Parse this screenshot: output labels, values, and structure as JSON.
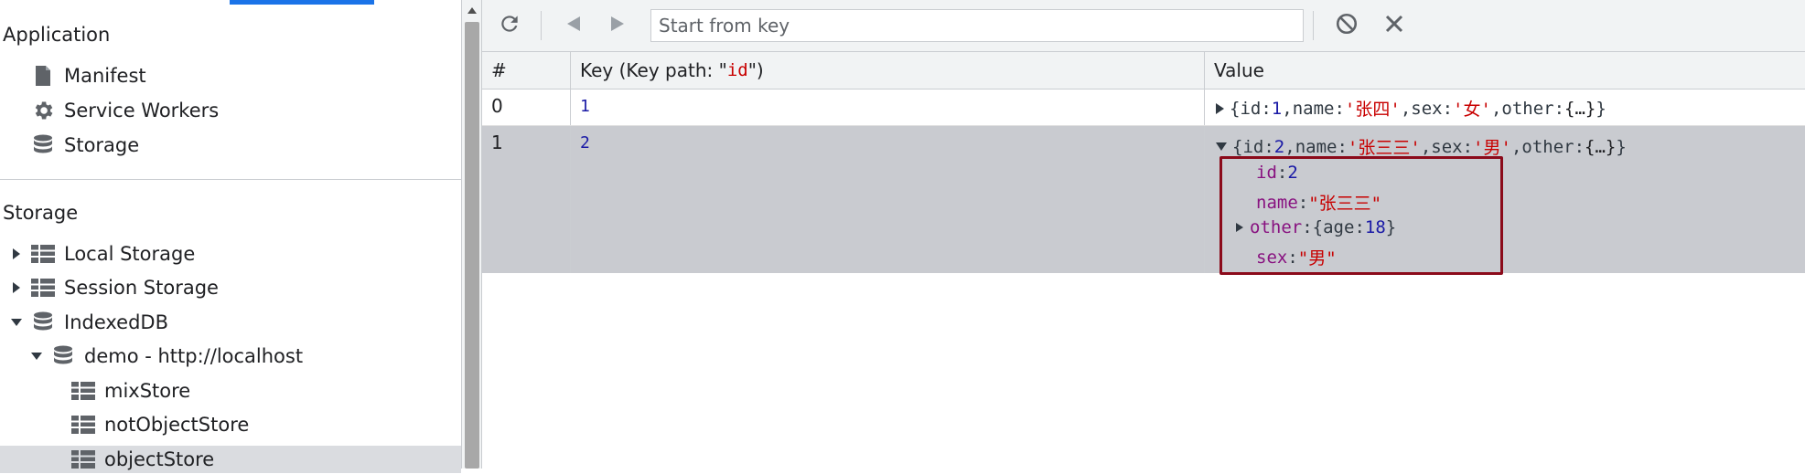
{
  "sidebar": {
    "application_title": "Application",
    "app_items": [
      "Manifest",
      "Service Workers",
      "Storage"
    ],
    "storage_title": "Storage",
    "storage_items": {
      "local_storage": "Local Storage",
      "session_storage": "Session Storage",
      "indexeddb": "IndexedDB",
      "database": "demo - http://localhost",
      "stores": [
        "mixStore",
        "notObjectStore",
        "objectStore"
      ]
    },
    "selected_store": "objectStore"
  },
  "toolbar": {
    "search_placeholder": "Start from key",
    "icons": [
      "refresh-icon",
      "prev-page-icon",
      "next-page-icon",
      "clear-icon",
      "delete-icon"
    ]
  },
  "table": {
    "headers": {
      "index": "#",
      "key_prefix": "Key (Key path: \"",
      "key_path": "id",
      "key_suffix": "\")",
      "value": "Value"
    },
    "rows": [
      {
        "index": "0",
        "key": "1",
        "value_preview": {
          "open": "{",
          "id_label": "id",
          "id": "1",
          "name_label": "name",
          "name": "'张四'",
          "sex_label": "sex",
          "sex": "'女'",
          "other_label": "other",
          "other": "{…}",
          "close": "}"
        }
      },
      {
        "index": "1",
        "key": "2",
        "expanded": true,
        "value_preview": {
          "open": "{",
          "id_label": "id",
          "id": "2",
          "name_label": "name",
          "name": "'张三三'",
          "sex_label": "sex",
          "sex": "'男'",
          "other_label": "other",
          "other": "{…}",
          "close": "}"
        },
        "properties": {
          "id_label": "id",
          "id": "2",
          "name_label": "name",
          "name": "\"张三三\"",
          "other_label": "other",
          "other_open": "{",
          "other_age_label": "age",
          "other_age": "18",
          "other_close": "}",
          "sex_label": "sex",
          "sex": "\"男\""
        }
      }
    ]
  },
  "colors": {
    "accent": "#1a73e8",
    "highlight_border": "#8b0a1a",
    "selected_row": "#c9cbd0"
  }
}
